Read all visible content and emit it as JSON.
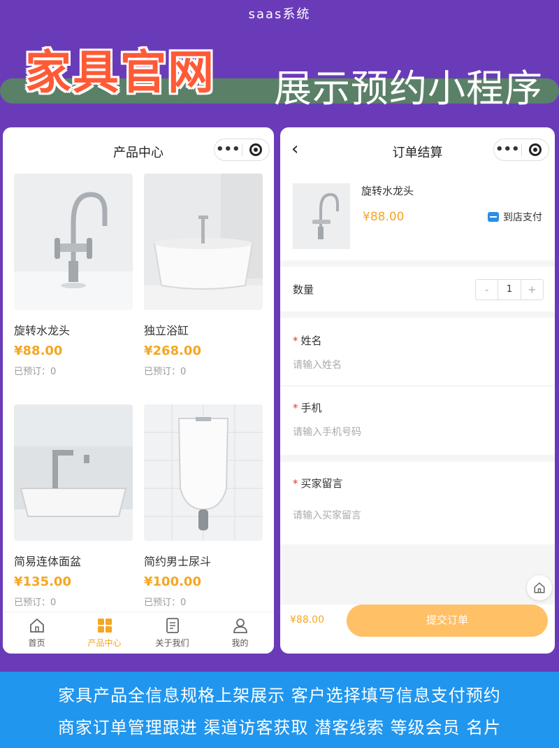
{
  "header": {
    "top_label": "saas系统",
    "main_title": "家具官网",
    "sub_title": "展示预约小程序"
  },
  "product_page": {
    "nav_title": "产品中心",
    "capsule_more": "•••",
    "products": [
      {
        "name": "旋转水龙头",
        "price": "¥88.00",
        "sold": "已预订：0"
      },
      {
        "name": "独立浴缸",
        "price": "¥268.00",
        "sold": "已预订：0"
      },
      {
        "name": "简易连体面盆",
        "price": "¥135.00",
        "sold": "已预订：0"
      },
      {
        "name": "简约男士尿斗",
        "price": "¥100.00",
        "sold": "已预订：0"
      }
    ],
    "tabs": [
      {
        "label": "首页",
        "icon": "home-icon"
      },
      {
        "label": "产品中心",
        "icon": "grid-icon"
      },
      {
        "label": "关于我们",
        "icon": "document-icon"
      },
      {
        "label": "我的",
        "icon": "user-icon"
      }
    ],
    "active_tab": "产品中心"
  },
  "order_page": {
    "nav_title": "订单结算",
    "capsule_more": "•••",
    "item": {
      "name": "旋转水龙头",
      "price": "¥88.00",
      "pay_method": "到店支付"
    },
    "quantity": {
      "label": "数量",
      "minus": "-",
      "value": "1",
      "plus": "+"
    },
    "fields": [
      {
        "label": "姓名",
        "placeholder": "请输入姓名",
        "required": "*"
      },
      {
        "label": "手机",
        "placeholder": "请输入手机号码",
        "required": "*"
      },
      {
        "label": "买家留言",
        "placeholder": "请输入买家留言",
        "required": "*"
      }
    ],
    "total": "¥88.00",
    "submit_label": "提交订单"
  },
  "footer": {
    "line1": "家具产品全信息规格上架展示 客户选择填写信息支付预约",
    "line2": "商家订单管理跟进 渠道访客获取 潜客线索 等级会员 名片"
  },
  "colors": {
    "background": "#6a3bb8",
    "accent_price": "#f5a623",
    "title_orange": "#ff5a36",
    "footer_blue": "#2196ee",
    "submit": "#ffc066"
  }
}
